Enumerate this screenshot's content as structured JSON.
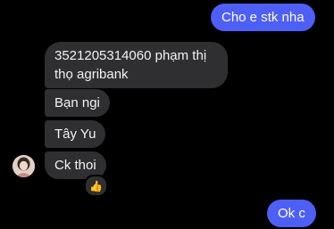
{
  "messages": {
    "out_1": "Cho e stk nha",
    "in_1": "3521205314060 phạm thị thọ agribank",
    "in_2": "Bạn ngi",
    "in_3": "Tây Yu",
    "in_4": "Ck thoi",
    "out_2": "Ok c"
  },
  "reaction": {
    "emoji": "👍",
    "icon": "thumbs-up-icon"
  },
  "colors": {
    "outgoing_bubble": "#4e5ff6",
    "incoming_bubble": "#2f2f31",
    "background": "#000000"
  }
}
